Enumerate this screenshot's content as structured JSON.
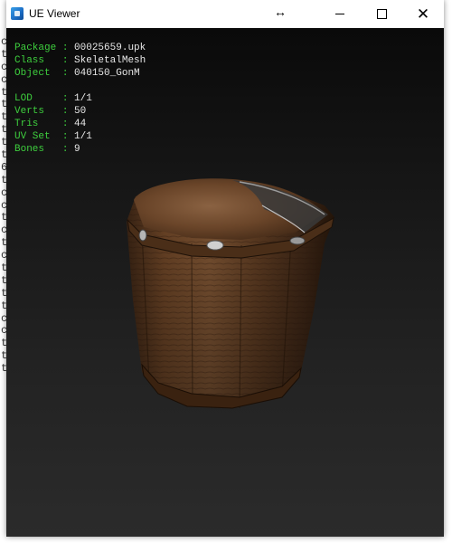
{
  "window": {
    "title": "UE Viewer",
    "resize_cursor_glyph": "↔",
    "controls": {
      "close_glyph": "✕"
    }
  },
  "info_panel": {
    "group1": [
      {
        "key": "Package",
        "sep": " : ",
        "value": "00025659.upk"
      },
      {
        "key": "Class  ",
        "sep": " : ",
        "value": "SkeletalMesh"
      },
      {
        "key": "Object ",
        "sep": " : ",
        "value": "040150_GonM"
      }
    ],
    "group2": [
      {
        "key": "LOD    ",
        "sep": " : ",
        "value": "1/1"
      },
      {
        "key": "Verts  ",
        "sep": " : ",
        "value": "50"
      },
      {
        "key": "Tris   ",
        "sep": " : ",
        "value": "44"
      },
      {
        "key": "UV Set ",
        "sep": " : ",
        "value": "1/1"
      },
      {
        "key": "Bones  ",
        "sep": " : ",
        "value": "9"
      }
    ]
  },
  "colors": {
    "label_green": "#3ecf3e",
    "value_white": "#e8e8e8",
    "viewport_top": "#0a0a0a",
    "viewport_bottom": "#2b2b2b"
  },
  "background_console": {
    "left": [
      "c",
      "t",
      "c",
      "c",
      "t",
      "t",
      "t",
      "t",
      "t",
      "t",
      "6",
      "t",
      "c",
      "c",
      "t",
      "c",
      "t",
      "c",
      "t",
      "t",
      "t",
      "t",
      "c",
      "c",
      "t",
      "t",
      "t"
    ],
    "right": [
      "",
      "",
      "",
      "",
      "",
      "",
      "",
      "",
      "",
      "",
      "",
      "",
      "",
      "",
      "",
      "",
      "",
      "",
      "",
      "",
      "",
      "",
      "",
      "",
      "",
      "",
      ""
    ]
  }
}
